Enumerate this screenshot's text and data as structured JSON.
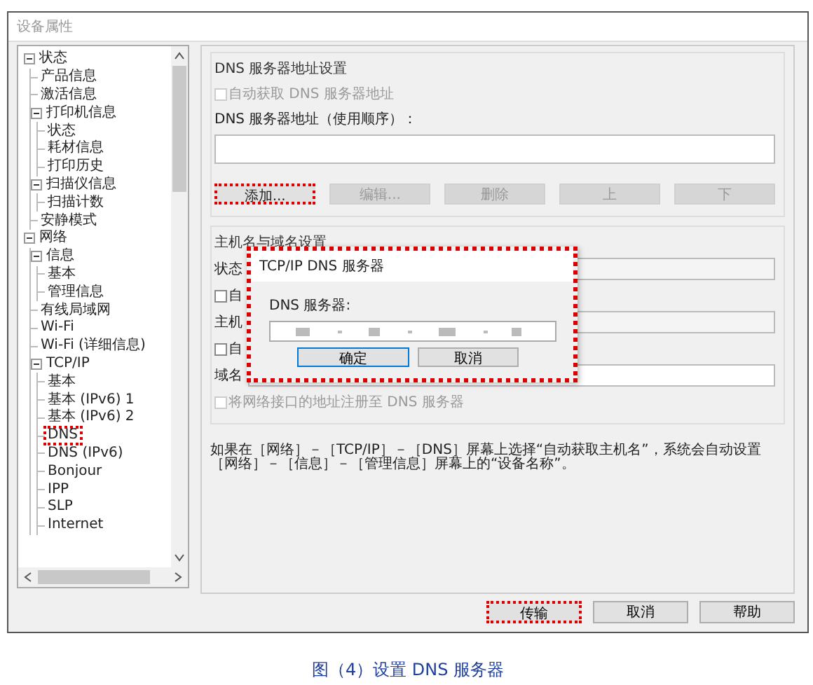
{
  "window": {
    "title": "设备属性"
  },
  "tree": [
    {
      "label": "状态",
      "expanded": true,
      "highlighted": false,
      "children": [
        {
          "label": "产品信息",
          "highlighted": false
        },
        {
          "label": "激活信息",
          "highlighted": false
        },
        {
          "label": "打印机信息",
          "expanded": true,
          "highlighted": false,
          "children": [
            {
              "label": "状态",
              "highlighted": false
            },
            {
              "label": "耗材信息",
              "highlighted": false
            },
            {
              "label": "打印历史",
              "highlighted": false
            }
          ]
        },
        {
          "label": "扫描仪信息",
          "expanded": true,
          "highlighted": false,
          "children": [
            {
              "label": "扫描计数",
              "highlighted": false
            }
          ]
        },
        {
          "label": "安静模式",
          "highlighted": false
        }
      ]
    },
    {
      "label": "网络",
      "expanded": true,
      "highlighted": false,
      "children": [
        {
          "label": "信息",
          "expanded": true,
          "highlighted": false,
          "children": [
            {
              "label": "基本",
              "highlighted": false
            },
            {
              "label": "管理信息",
              "highlighted": false
            }
          ]
        },
        {
          "label": "有线局域网",
          "highlighted": false
        },
        {
          "label": "Wi-Fi",
          "highlighted": false
        },
        {
          "label": "Wi-Fi (详细信息)",
          "highlighted": false
        },
        {
          "label": "TCP/IP",
          "expanded": true,
          "highlighted": false,
          "children": [
            {
              "label": "基本",
              "highlighted": false
            },
            {
              "label": "基本 (IPv6) 1",
              "highlighted": false
            },
            {
              "label": "基本 (IPv6) 2",
              "highlighted": false
            },
            {
              "label": "DNS",
              "highlighted": true
            },
            {
              "label": "DNS (IPv6)",
              "highlighted": false
            },
            {
              "label": "Bonjour",
              "highlighted": false
            },
            {
              "label": "IPP",
              "highlighted": false
            },
            {
              "label": "SLP",
              "highlighted": false
            },
            {
              "label": "Internet",
              "highlighted": false
            }
          ]
        }
      ]
    }
  ],
  "dns_group": {
    "title": "DNS 服务器地址设置",
    "auto_checkbox": {
      "label": "自动获取 DNS 服务器地址",
      "checked": false,
      "disabled": true
    },
    "list_label": "DNS 服务器地址（使用顺序）：",
    "buttons": [
      {
        "label": "添加...",
        "disabled": false,
        "highlighted": true
      },
      {
        "label": "编辑...",
        "disabled": true,
        "highlighted": false
      },
      {
        "label": "删除",
        "disabled": true,
        "highlighted": false
      },
      {
        "label": "上",
        "disabled": true,
        "highlighted": false
      },
      {
        "label": "下",
        "disabled": true,
        "highlighted": false
      }
    ]
  },
  "host_group": {
    "title": "主机名与域名设置",
    "rows": [
      {
        "kind": "field",
        "label": "状态"
      },
      {
        "kind": "checkbox",
        "label": "自",
        "checked": false,
        "disabled": false
      },
      {
        "kind": "field",
        "label": "主机"
      },
      {
        "kind": "checkbox",
        "label": "自",
        "checked": false,
        "disabled": false
      },
      {
        "kind": "field",
        "label": "域名"
      },
      {
        "kind": "checkbox",
        "label": "将网络接口的地址注册至 DNS 服务器",
        "checked": false,
        "disabled": true
      }
    ]
  },
  "note": "如果在［网络］－［TCP/IP］－［DNS］屏幕上选择“自动获取主机名”，系统会自动设置［网络］－［信息］－［管理信息］屏幕上的“设备名称”。",
  "dialog": {
    "title": "TCP/IP DNS 服务器",
    "label": "DNS 服务器:",
    "highlighted": true,
    "buttons": [
      {
        "label": "确定",
        "default": true
      },
      {
        "label": "取消",
        "default": false
      }
    ]
  },
  "footer_buttons": [
    {
      "label": "传输",
      "highlighted": true
    },
    {
      "label": "取消",
      "highlighted": false
    },
    {
      "label": "帮助",
      "highlighted": false
    }
  ],
  "caption": "图（4）设置 DNS 服务器"
}
